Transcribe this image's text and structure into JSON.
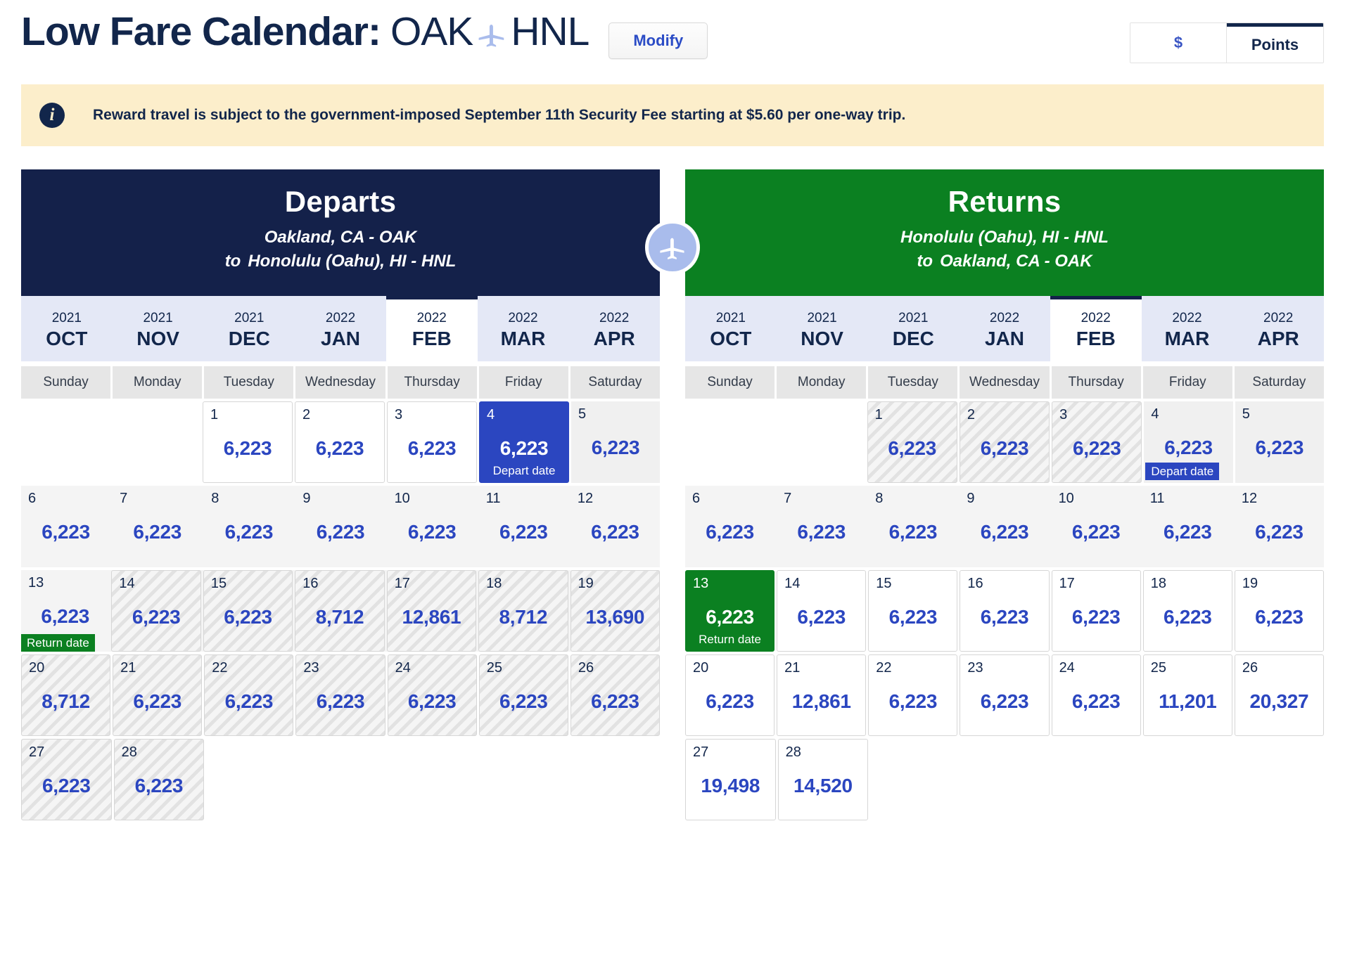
{
  "header": {
    "title_prefix": "Low Fare Calendar:",
    "origin_code": "OAK",
    "dest_code": "HNL",
    "plane_icon": "airplane-icon",
    "modify_label": "Modify",
    "currency": {
      "dollar_label": "$",
      "points_label": "Points",
      "active": "Points"
    }
  },
  "banner": {
    "icon": "info-icon",
    "text": "Reward travel is subject to the government-imposed September 11th Security Fee starting at $5.60 per one-way trip."
  },
  "center_icon": "airplane-circle-icon",
  "depart": {
    "heading": "Departs",
    "from": "Oakland, CA - OAK",
    "to_label": "to",
    "to": "Honolulu (Oahu), HI - HNL",
    "months": [
      {
        "year": "2021",
        "month": "OCT",
        "active": false
      },
      {
        "year": "2021",
        "month": "NOV",
        "active": false
      },
      {
        "year": "2021",
        "month": "DEC",
        "active": false
      },
      {
        "year": "2022",
        "month": "JAN",
        "active": false
      },
      {
        "year": "2022",
        "month": "FEB",
        "active": true
      },
      {
        "year": "2022",
        "month": "MAR",
        "active": false
      },
      {
        "year": "2022",
        "month": "APR",
        "active": false
      }
    ],
    "weekdays": [
      "Sunday",
      "Monday",
      "Tuesday",
      "Wednesday",
      "Thursday",
      "Friday",
      "Saturday"
    ],
    "weeks": [
      {
        "band": false,
        "days": [
          {
            "empty": true
          },
          {
            "empty": true
          },
          {
            "day": "1",
            "points": "6,223",
            "style": "card"
          },
          {
            "day": "2",
            "points": "6,223",
            "style": "card"
          },
          {
            "day": "3",
            "points": "6,223",
            "style": "card"
          },
          {
            "day": "4",
            "points": "6,223",
            "style": "sel-depart",
            "badge": "Depart date",
            "badge_type": "depart"
          },
          {
            "day": "5",
            "points": "6,223",
            "style": "shade"
          }
        ]
      },
      {
        "band": true,
        "days": [
          {
            "day": "6",
            "points": "6,223",
            "style": "flat"
          },
          {
            "day": "7",
            "points": "6,223",
            "style": "flat"
          },
          {
            "day": "8",
            "points": "6,223",
            "style": "flat"
          },
          {
            "day": "9",
            "points": "6,223",
            "style": "flat"
          },
          {
            "day": "10",
            "points": "6,223",
            "style": "flat"
          },
          {
            "day": "11",
            "points": "6,223",
            "style": "flat"
          },
          {
            "day": "12",
            "points": "6,223",
            "style": "flat"
          }
        ]
      },
      {
        "band": true,
        "days": [
          {
            "day": "13",
            "points": "6,223",
            "style": "flat",
            "badge": "Return date",
            "badge_type": "return"
          },
          {
            "day": "14",
            "points": "6,223",
            "style": "striped"
          },
          {
            "day": "15",
            "points": "6,223",
            "style": "striped"
          },
          {
            "day": "16",
            "points": "8,712",
            "style": "striped"
          },
          {
            "day": "17",
            "points": "12,861",
            "style": "striped"
          },
          {
            "day": "18",
            "points": "8,712",
            "style": "striped"
          },
          {
            "day": "19",
            "points": "13,690",
            "style": "striped"
          }
        ]
      },
      {
        "band": false,
        "days": [
          {
            "day": "20",
            "points": "8,712",
            "style": "striped"
          },
          {
            "day": "21",
            "points": "6,223",
            "style": "striped"
          },
          {
            "day": "22",
            "points": "6,223",
            "style": "striped"
          },
          {
            "day": "23",
            "points": "6,223",
            "style": "striped"
          },
          {
            "day": "24",
            "points": "6,223",
            "style": "striped"
          },
          {
            "day": "25",
            "points": "6,223",
            "style": "striped"
          },
          {
            "day": "26",
            "points": "6,223",
            "style": "striped"
          }
        ]
      },
      {
        "band": false,
        "days": [
          {
            "day": "27",
            "points": "6,223",
            "style": "striped"
          },
          {
            "day": "28",
            "points": "6,223",
            "style": "striped"
          },
          {
            "empty": true
          },
          {
            "empty": true
          },
          {
            "empty": true
          },
          {
            "empty": true
          },
          {
            "empty": true
          }
        ]
      }
    ]
  },
  "returns": {
    "heading": "Returns",
    "from": "Honolulu (Oahu), HI - HNL",
    "to_label": "to",
    "to": "Oakland, CA - OAK",
    "months": [
      {
        "year": "2021",
        "month": "OCT",
        "active": false
      },
      {
        "year": "2021",
        "month": "NOV",
        "active": false
      },
      {
        "year": "2021",
        "month": "DEC",
        "active": false
      },
      {
        "year": "2022",
        "month": "JAN",
        "active": false
      },
      {
        "year": "2022",
        "month": "FEB",
        "active": true
      },
      {
        "year": "2022",
        "month": "MAR",
        "active": false
      },
      {
        "year": "2022",
        "month": "APR",
        "active": false
      }
    ],
    "weekdays": [
      "Sunday",
      "Monday",
      "Tuesday",
      "Wednesday",
      "Thursday",
      "Friday",
      "Saturday"
    ],
    "weeks": [
      {
        "band": false,
        "days": [
          {
            "empty": true
          },
          {
            "empty": true
          },
          {
            "day": "1",
            "points": "6,223",
            "style": "striped"
          },
          {
            "day": "2",
            "points": "6,223",
            "style": "striped"
          },
          {
            "day": "3",
            "points": "6,223",
            "style": "striped"
          },
          {
            "day": "4",
            "points": "6,223",
            "style": "shade",
            "badge": "Depart date",
            "badge_type": "inline-depart"
          },
          {
            "day": "5",
            "points": "6,223",
            "style": "shade"
          }
        ]
      },
      {
        "band": true,
        "days": [
          {
            "day": "6",
            "points": "6,223",
            "style": "flat"
          },
          {
            "day": "7",
            "points": "6,223",
            "style": "flat"
          },
          {
            "day": "8",
            "points": "6,223",
            "style": "flat"
          },
          {
            "day": "9",
            "points": "6,223",
            "style": "flat"
          },
          {
            "day": "10",
            "points": "6,223",
            "style": "flat"
          },
          {
            "day": "11",
            "points": "6,223",
            "style": "flat"
          },
          {
            "day": "12",
            "points": "6,223",
            "style": "flat"
          }
        ]
      },
      {
        "band": false,
        "days": [
          {
            "day": "13",
            "points": "6,223",
            "style": "sel-return",
            "badge": "Return date",
            "badge_type": "return"
          },
          {
            "day": "14",
            "points": "6,223",
            "style": "card"
          },
          {
            "day": "15",
            "points": "6,223",
            "style": "card"
          },
          {
            "day": "16",
            "points": "6,223",
            "style": "card"
          },
          {
            "day": "17",
            "points": "6,223",
            "style": "card"
          },
          {
            "day": "18",
            "points": "6,223",
            "style": "card"
          },
          {
            "day": "19",
            "points": "6,223",
            "style": "card"
          }
        ]
      },
      {
        "band": false,
        "days": [
          {
            "day": "20",
            "points": "6,223",
            "style": "card"
          },
          {
            "day": "21",
            "points": "12,861",
            "style": "card"
          },
          {
            "day": "22",
            "points": "6,223",
            "style": "card"
          },
          {
            "day": "23",
            "points": "6,223",
            "style": "card"
          },
          {
            "day": "24",
            "points": "6,223",
            "style": "card"
          },
          {
            "day": "25",
            "points": "11,201",
            "style": "card"
          },
          {
            "day": "26",
            "points": "20,327",
            "style": "card"
          }
        ]
      },
      {
        "band": false,
        "days": [
          {
            "day": "27",
            "points": "19,498",
            "style": "card"
          },
          {
            "day": "28",
            "points": "14,520",
            "style": "card"
          },
          {
            "empty": true
          },
          {
            "empty": true
          },
          {
            "empty": true
          },
          {
            "empty": true
          },
          {
            "empty": true
          }
        ]
      }
    ]
  },
  "colors": {
    "navy": "#14214a",
    "green": "#0b8021",
    "blue": "#2b46c0",
    "banner_bg": "#fceecb",
    "tab_bg": "#e4e8f6"
  }
}
